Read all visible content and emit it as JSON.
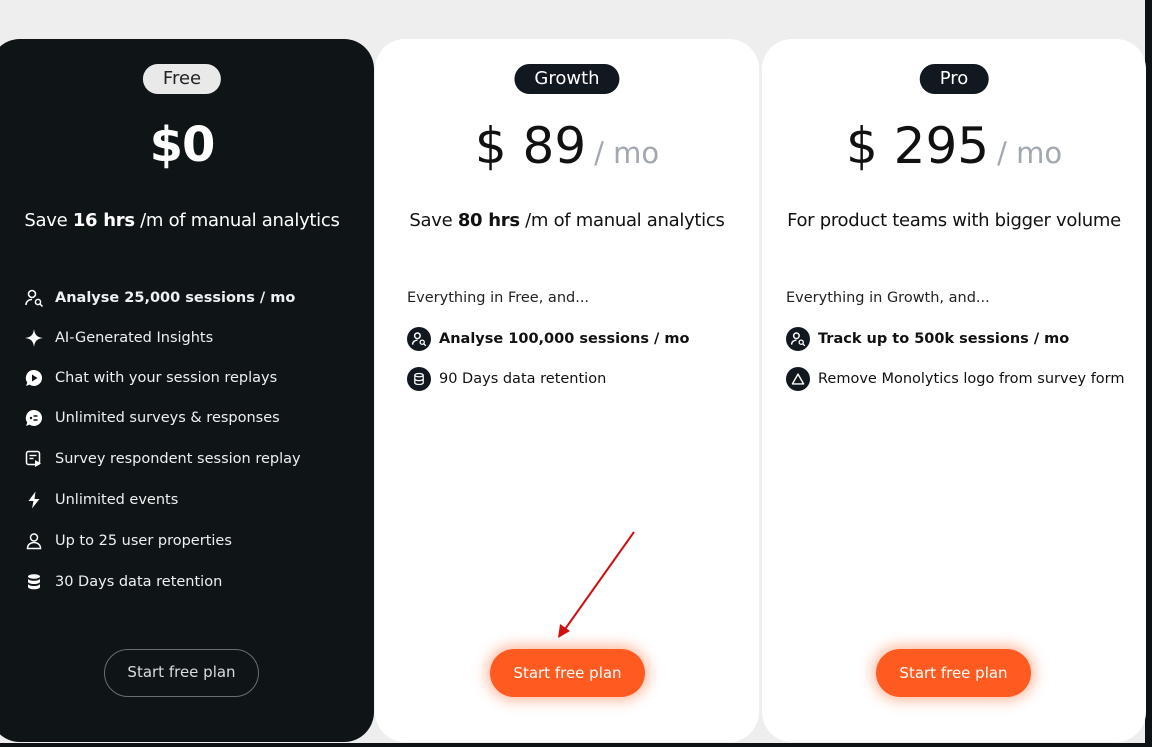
{
  "plans": [
    {
      "badge": "Free",
      "price": "$0",
      "per": "",
      "tagline_pre": "Save ",
      "tagline_bold": "16 hrs",
      "tagline_post": " /m of manual analytics",
      "intro": "",
      "features": [
        {
          "icon": "user-search-icon",
          "bold": "Analyse 25,000 sessions / mo",
          "text": ""
        },
        {
          "icon": "sparkle-icon",
          "bold": "",
          "text": "AI-Generated Insights"
        },
        {
          "icon": "play-chat-icon",
          "bold": "",
          "text": "Chat with your session replays"
        },
        {
          "icon": "chat-bubble-icon",
          "bold": "",
          "text": "Unlimited surveys & responses"
        },
        {
          "icon": "replay-form-icon",
          "bold": "",
          "text": "Survey respondent session replay"
        },
        {
          "icon": "lightning-icon",
          "bold": "",
          "text": "Unlimited events"
        },
        {
          "icon": "user-icon",
          "bold": "",
          "text": "Up to 25 user properties"
        },
        {
          "icon": "database-icon",
          "bold": "",
          "text": "30 Days data retention"
        }
      ],
      "cta": "Start free plan"
    },
    {
      "badge": "Growth",
      "price": "$ 89",
      "per": "/ mo",
      "tagline_pre": "Save ",
      "tagline_bold": "80 hrs",
      "tagline_post": " /m of manual analytics",
      "intro": "Everything in Free, and...",
      "features": [
        {
          "icon": "user-search-icon",
          "bold": "Analyse 100,000 sessions / mo",
          "text": ""
        },
        {
          "icon": "database-icon",
          "bold": "",
          "text": "90 Days data retention"
        }
      ],
      "cta": "Start free plan"
    },
    {
      "badge": "Pro",
      "price": "$ 295",
      "per": "/ mo",
      "tagline_pre": "For product teams with bigger volume",
      "tagline_bold": "",
      "tagline_post": "",
      "intro": "Everything in Growth, and...",
      "features": [
        {
          "icon": "user-search-icon",
          "bold": "Track up to 500k sessions / mo",
          "text": ""
        },
        {
          "icon": "triangle-icon",
          "bold": "",
          "text": "Remove Monolytics logo from survey form"
        }
      ],
      "cta": "Start free plan"
    }
  ],
  "colors": {
    "accent": "#ff5a1f",
    "dark_card": "#0f1417",
    "badge_dark": "#121820",
    "annotation_arrow": "#d01010"
  }
}
